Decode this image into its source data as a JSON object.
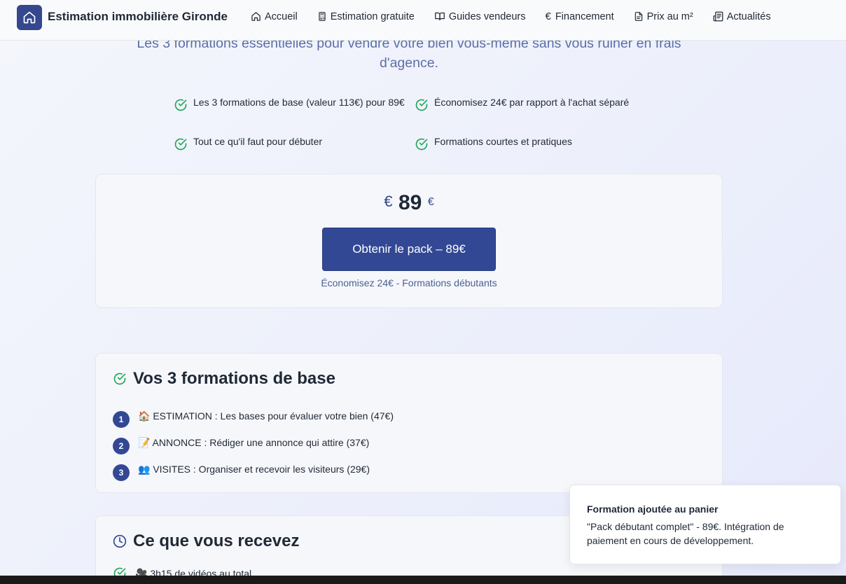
{
  "header": {
    "site_title": "Estimation immobilière Gironde",
    "nav": [
      {
        "label": "Accueil",
        "icon": "home-icon"
      },
      {
        "label": "Estimation gratuite",
        "icon": "calculator-icon"
      },
      {
        "label": "Guides vendeurs",
        "icon": "book-icon"
      },
      {
        "label": "Financement",
        "icon": "euro-icon"
      },
      {
        "label": "Prix au m²",
        "icon": "file-text-icon"
      },
      {
        "label": "Actualités",
        "icon": "newspaper-icon"
      }
    ]
  },
  "hero": {
    "subtitle": "Les 3 formations essentielles pour vendre votre bien vous-même sans vous ruiner en frais d'agence.",
    "benefits": [
      "Les 3 formations de base (valeur 113€) pour 89€",
      "Économisez 24€ par rapport à l'achat séparé",
      "Tout ce qu'il faut pour débuter",
      "Formations courtes et pratiques"
    ]
  },
  "pricing": {
    "currency_symbol": "€",
    "amount": "89",
    "currency_suffix": "€",
    "cta_label": "Obtenir le pack – 89€",
    "savings_note": "Économisez 24€ - Formations débutants"
  },
  "formations_card": {
    "title": "Vos 3 formations de base",
    "items": [
      {
        "num": "1",
        "text": "🏠 ESTIMATION : Les bases pour évaluer votre bien (47€)"
      },
      {
        "num": "2",
        "text": "📝 ANNONCE : Rédiger une annonce qui attire (37€)"
      },
      {
        "num": "3",
        "text": "👥 VISITES : Organiser et recevoir les visiteurs (29€)"
      }
    ]
  },
  "receive_card": {
    "title": "Ce que vous recevez",
    "items": [
      "🎥 3h15 de vidéos au total"
    ]
  },
  "toast": {
    "title": "Formation ajoutée au panier",
    "body": "\"Pack débutant complet\" - 89€. Intégration de paiement en cours de développement."
  },
  "colors": {
    "primary": "#334894",
    "check_green": "#22a55a",
    "subtitle_blue": "#5b6fa6"
  }
}
